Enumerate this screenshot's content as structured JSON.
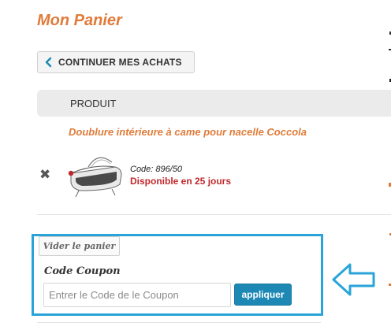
{
  "cart": {
    "title": "Mon Panier",
    "continue_shopping_label": "CONTINUER MES ACHATS",
    "table_header_product": "PRODUIT",
    "product": {
      "name": "Doublure intérieure à came pour nacelle Coccola",
      "code": "Code: 896/50",
      "availability": "Disponible en 25 jours",
      "remove_icon": "close-icon"
    },
    "empty_cart_label": "Vider le panier",
    "coupon": {
      "label": "Code Coupon",
      "placeholder": "Entrer le Code de le Coupon",
      "value": "",
      "apply_label": "appliquer"
    }
  },
  "colors": {
    "accent_orange": "#e07b39",
    "availability_red": "#c0282d",
    "highlight_blue": "#2aa4d8",
    "button_blue": "#1d88b4"
  },
  "icons": {
    "continue": "chevron-left-icon",
    "callout": "arrow-left-outline-icon"
  }
}
